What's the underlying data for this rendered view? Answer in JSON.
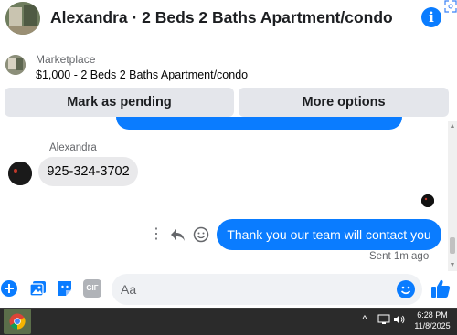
{
  "header": {
    "title": "Alexandra · 2 Beds 2 Baths Apartment/condo",
    "avatar_icon": "profile-photo",
    "info_icon": "info-icon"
  },
  "marketplace": {
    "label": "Marketplace",
    "listing": "$1,000 - 2 Beds 2 Baths Apartment/condo",
    "buttons": {
      "pending": "Mark as pending",
      "more": "More options"
    }
  },
  "conversation": {
    "sender_name": "Alexandra",
    "incoming_message": "925-324-3702",
    "outgoing_message": "Thank you our team will contact you",
    "sent_status": "Sent 1m ago"
  },
  "composer": {
    "placeholder": "Aa",
    "gif_label": "GIF"
  },
  "taskbar": {
    "time": "6:28 PM",
    "date": "11/8/2025"
  },
  "colors": {
    "accent": "#0a7cff",
    "button_bg": "#e4e6eb",
    "incoming_bubble": "#e9e9eb",
    "taskbar": "#2b2b2b"
  }
}
